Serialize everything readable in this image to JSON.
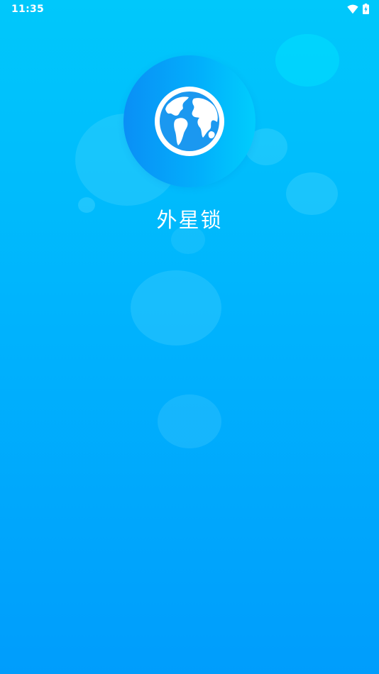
{
  "status_bar": {
    "time": "11:35",
    "icons": [
      "wifi-icon",
      "battery-charging-icon"
    ]
  },
  "splash": {
    "logo_icon": "globe-icon",
    "app_name": "外星锁"
  },
  "colors": {
    "background_top": "#00c8fb",
    "background_bottom": "#009dfc",
    "logo_circle_left": "#0a8ff6",
    "logo_circle_right": "#00cdfd",
    "foreground": "#ffffff"
  }
}
